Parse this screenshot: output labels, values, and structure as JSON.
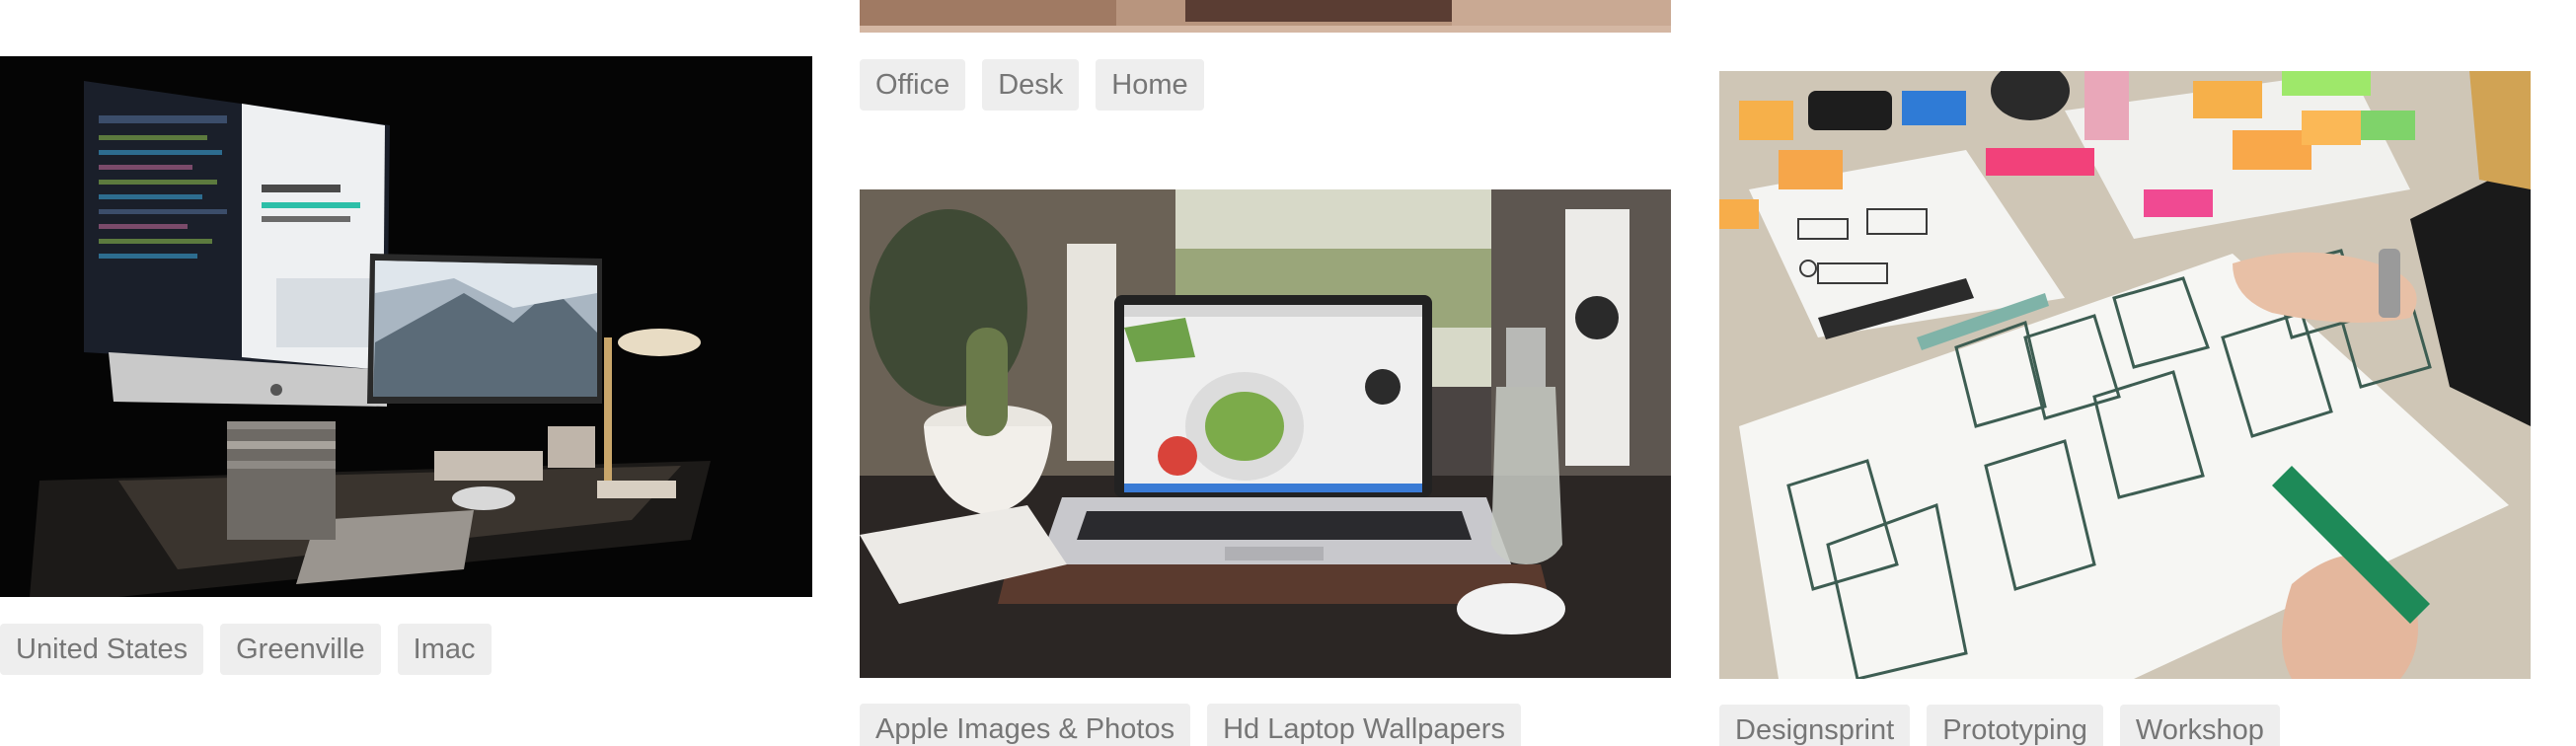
{
  "columns": [
    {
      "photo_alt": "Desk setup with iMac, monitor and lamp in a dark room",
      "tags": [
        "United States",
        "Greenville",
        "Imac"
      ]
    },
    {
      "photo_alt": "Laptop on a desk with a cactus and a glass bottle",
      "top_tags": [
        "Office",
        "Desk",
        "Home"
      ],
      "tags": [
        "Apple Images & Photos",
        "Hd Laptop Wallpapers"
      ]
    },
    {
      "photo_alt": "Hands sketching paper wireframes with sticky notes",
      "tags": [
        "Designsprint",
        "Prototyping",
        "Workshop"
      ]
    }
  ],
  "colors": {
    "tag_background": "#eeeeee",
    "tag_text": "#767676",
    "page_background": "#ffffff"
  }
}
